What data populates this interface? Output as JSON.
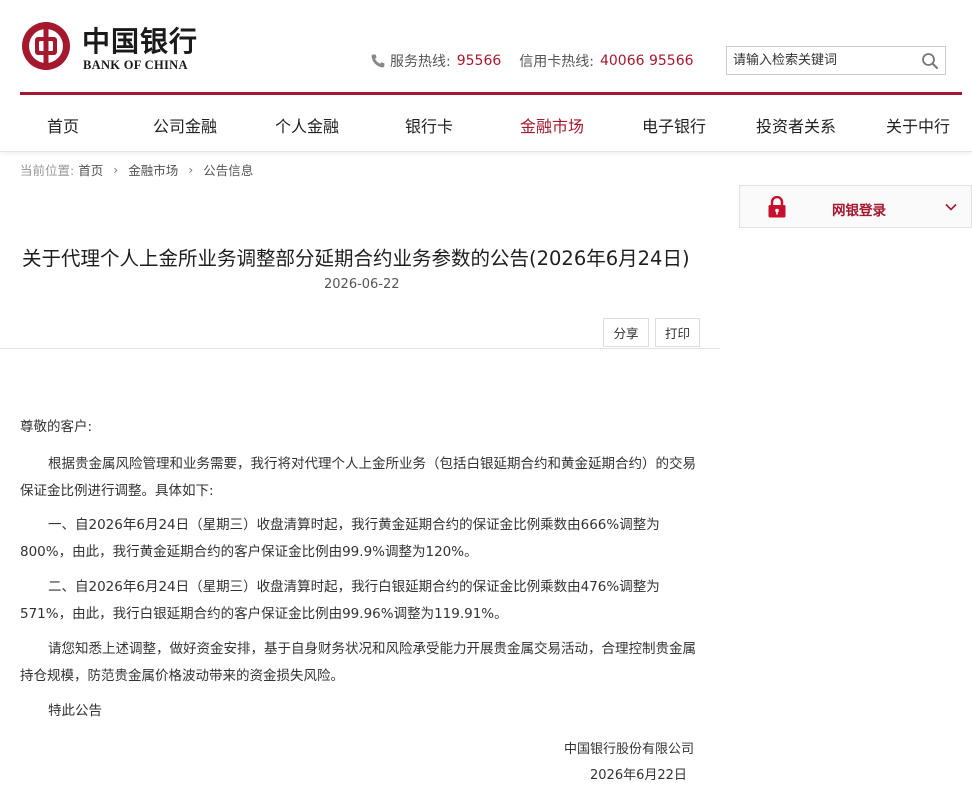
{
  "brand": {
    "name_cn": "中国银行",
    "name_en": "BANK OF CHINA",
    "accent": "#a5192f"
  },
  "header": {
    "hotline_label": "服务热线:",
    "hotline_number": "95566",
    "card_hotline_label": "信用卡热线:",
    "card_hotline_number": "40066 95566",
    "search_placeholder": "请输入检索关键词",
    "search_icon": "search-icon",
    "phone_icon": "phone-icon"
  },
  "nav": {
    "items": [
      "首页",
      "公司金融",
      "个人金融",
      "银行卡",
      "金融市场",
      "电子银行",
      "投资者关系",
      "关于中行"
    ],
    "active": "金融市场"
  },
  "breadcrumb": {
    "prefix": "当前位置:",
    "items": [
      "首页",
      "金融市场",
      "公告信息"
    ]
  },
  "login": {
    "label": "网银登录",
    "icon": "lock-icon"
  },
  "article": {
    "title": "关于代理个人上金所业务调整部分延期合约业务参数的公告(2026年6月24日)",
    "date": "2026-06-22",
    "share_label": "分享",
    "print_label": "打印",
    "greeting": "尊敬的客户:",
    "paragraphs": [
      "根据贵金属风险管理和业务需要，我行将对代理个人上金所业务（包括白银延期合约和黄金延期合约）的交易保证金比例进行调整。具体如下:",
      "一、自2026年6月24日（星期三）收盘清算时起，我行黄金延期合约的保证金比例乘数由666%调整为800%，由此，我行黄金延期合约的客户保证金比例由99.9%调整为120%。",
      "二、自2026年6月24日（星期三）收盘清算时起，我行白银延期合约的保证金比例乘数由476%调整为571%，由此，我行白银延期合约的客户保证金比例由99.96%调整为119.91%。",
      "请您知悉上述调整，做好资金安排，基于自身财务状况和风险承受能力开展贵金属交易活动，合理控制贵金属持仓规模，防范贵金属价格波动带来的资金损失风险。",
      "特此公告"
    ],
    "signature_company": "中国银行股份有限公司",
    "signature_date": "2026年6月22日"
  }
}
